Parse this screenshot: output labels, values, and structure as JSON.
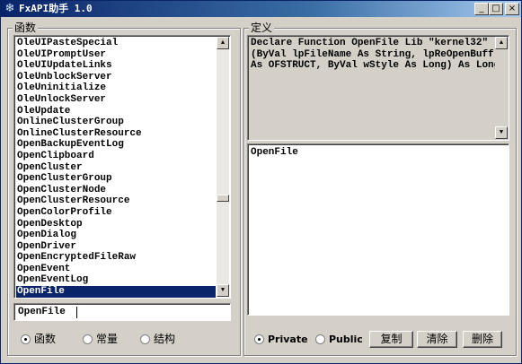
{
  "window": {
    "title": "FxAPI助手 1.0"
  },
  "title_buttons": {
    "minimize": "_",
    "maximize": "□",
    "close": "×"
  },
  "left_group": {
    "label": "函数"
  },
  "right_group": {
    "label": "定义"
  },
  "function_list": {
    "items": [
      "OleUIPasteSpecial",
      "OleUIPromptUser",
      "OleUIUpdateLinks",
      "OleUnblockServer",
      "OleUninitialize",
      "OleUnlockServer",
      "OleUpdate",
      "OnlineClusterGroup",
      "OnlineClusterResource",
      "OpenBackupEventLog",
      "OpenClipboard",
      "OpenCluster",
      "OpenClusterGroup",
      "OpenClusterNode",
      "OpenClusterResource",
      "OpenColorProfile",
      "OpenDesktop",
      "OpenDialog",
      "OpenDriver",
      "OpenEncryptedFileRaw",
      "OpenEvent",
      "OpenEventLog",
      "OpenFile"
    ],
    "selected": "OpenFile"
  },
  "search": {
    "value": "OpenFile"
  },
  "type_radios": [
    {
      "label": "函数",
      "checked": true
    },
    {
      "label": "常量",
      "checked": false
    },
    {
      "label": "结构",
      "checked": false
    }
  ],
  "definition": {
    "text": "Declare Function OpenFile Lib \"kernel32\"\n(ByVal lpFileName As String, lpReOpenBuff\nAs OFSTRUCT, ByVal wStyle As Long) As Long"
  },
  "output": {
    "text": "OpenFile"
  },
  "scope_radios": [
    {
      "label": "Private",
      "checked": true
    },
    {
      "label": "Public",
      "checked": false
    }
  ],
  "actions": {
    "copy": "复制",
    "clear": "清除",
    "delete": "删除"
  },
  "icons": {
    "app": "snowflake-icon",
    "scroll_up": "arrow-up-icon",
    "scroll_down": "arrow-down-icon"
  }
}
